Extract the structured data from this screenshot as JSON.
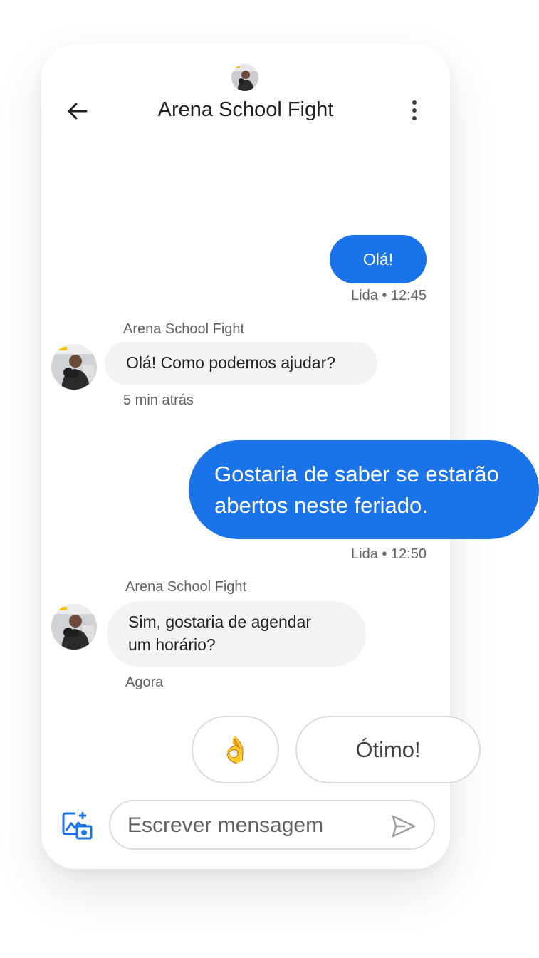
{
  "header": {
    "title": "Arena School Fight",
    "back_icon": "arrow-left-icon",
    "more_icon": "more-vertical-icon"
  },
  "colors": {
    "accent": "#1a73e8",
    "incoming_bubble": "#f1f3f4",
    "meta_text": "#5f6368"
  },
  "messages": [
    {
      "direction": "out",
      "text": "Olá!",
      "meta": "Lida • 12:45"
    },
    {
      "direction": "in",
      "sender": "Arena School Fight",
      "text": "Olá! Como podemos ajudar?",
      "meta": "5 min atrás"
    },
    {
      "direction": "out",
      "lines": [
        "Gostaria de saber se estarão",
        "abertos neste feriado."
      ],
      "meta": "Lida • 12:50"
    },
    {
      "direction": "in",
      "sender": "Arena School Fight",
      "lines": [
        "Sim, gostaria de agendar",
        "um horário?"
      ],
      "meta": "Agora"
    }
  ],
  "suggestions": [
    {
      "label": "👌",
      "icon": "ok-hand-emoji"
    },
    {
      "label": "Ótimo!"
    }
  ],
  "composer": {
    "placeholder": "Escrever mensagem",
    "attach_icon": "add-photo-icon",
    "send_icon": "send-icon"
  }
}
